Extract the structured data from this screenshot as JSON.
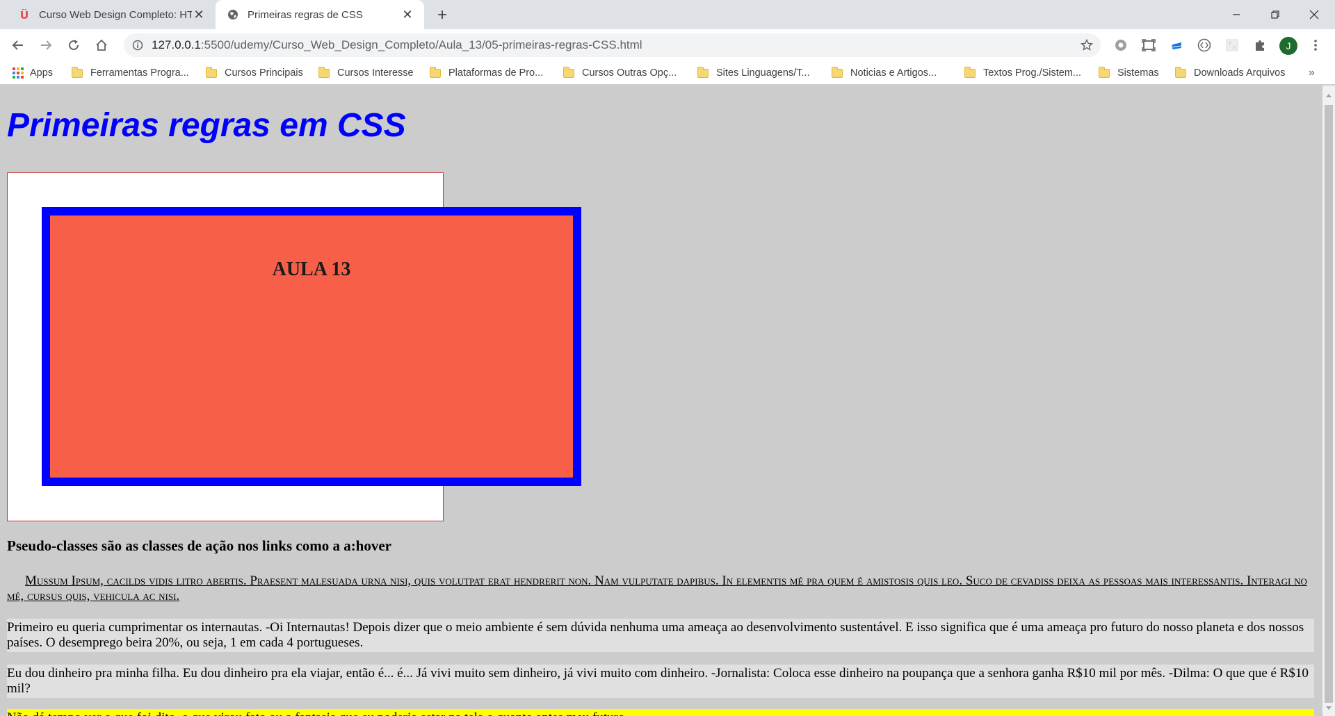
{
  "browser": {
    "tabs": [
      {
        "title": "Curso Web Design Completo: HTML",
        "active": false,
        "icon": "udemy-icon"
      },
      {
        "title": "Primeiras regras de CSS",
        "active": true,
        "icon": "globe-icon"
      }
    ],
    "new_tab": "+",
    "window_controls": {
      "minimize": "—",
      "maximize": "❐",
      "close": "✕"
    },
    "url_host": "127.0.0.1",
    "url_path": ":5500/udemy/Curso_Web_Design_Completo/Aula_13/05-primeiras-regras-CSS.html",
    "avatar_letter": "J",
    "bookmarks": [
      "Apps",
      "Ferramentas Progra...",
      "Cursos Principais",
      "Cursos Interesse",
      "Plataformas de Pro...",
      "Cursos Outras Opç...",
      "Sites Linguagens/T...",
      "Noticias e Artigos...",
      "Textos Prog./Sistem...",
      "Sistemas",
      "Downloads Arquivos"
    ],
    "bookmarks_more": "»"
  },
  "page": {
    "heading": "Primeiras regras em CSS",
    "box_label": "AULA 13",
    "subheading": "Pseudo-classes são as classes de ação nos links como a a:hover",
    "link_paragraph": "Mussum Ipsum, cacilds vidis litro abertis. Praesent malesuada urna nisi, quis volutpat erat hendrerit non. Nam vulputate dapibus. In elementis mé pra quem é amistosis quis leo. Suco de cevadiss deixa as pessoas mais interessantis. Interagi no mé, cursus quis, vehicula ac nisi.",
    "paragraph_1": "Primeiro eu queria cumprimentar os internautas. -Oi Internautas! Depois dizer que o meio ambiente é sem dúvida nenhuma uma ameaça ao desenvolvimento sustentável. E isso significa que é uma ameaça pro futuro do nosso planeta e dos nossos países. O desemprego beira 20%, ou seja, 1 em cada 4 portugueses.",
    "paragraph_2": "Eu dou dinheiro pra minha filha. Eu dou dinheiro pra ela viajar, então é... é... Já vivi muito sem dinheiro, já vivi muito com dinheiro. -Jornalista: Coloca esse dinheiro na poupança que a senhora ganha R$10 mil por mês. -Dilma: O que que é R$10 mil?",
    "paragraph_3": "Não dá tempo ver o que foi dito, o que virou fato ou a fantasia que eu poderia estar na tela o quanto antes meu futuro."
  },
  "colors": {
    "page_bg": "#cccccc",
    "heading": "#0000ff",
    "outer_box_border": "#d13030",
    "inner_box_bg": "#f75f48",
    "inner_box_border": "#0000ff",
    "yellow_highlight": "#ffff00"
  }
}
